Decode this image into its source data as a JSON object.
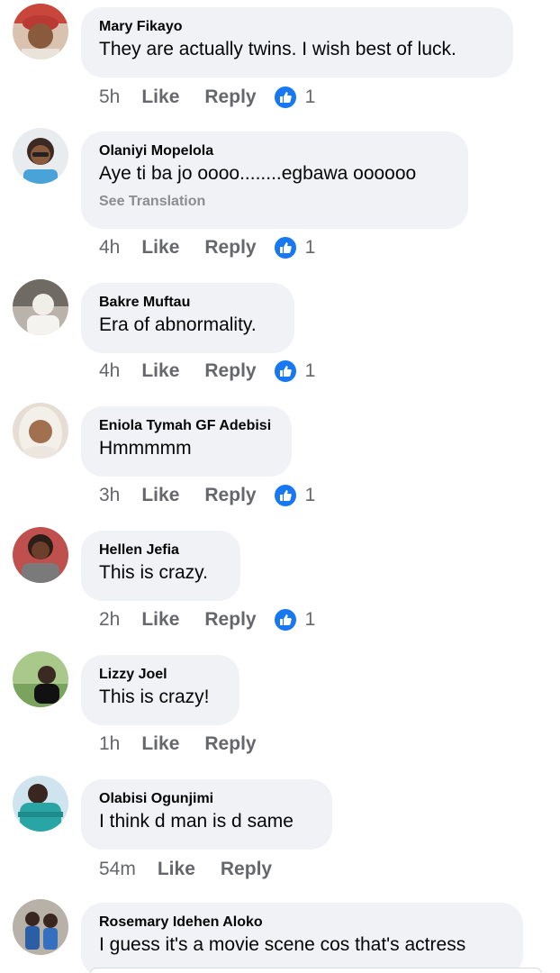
{
  "comments": [
    {
      "name": "Mary Fikayo",
      "text": "They are actually twins. I wish best of luck.",
      "time": "5h",
      "like": "Like",
      "reply": "Reply",
      "reactions": "1",
      "avatar": "avatar-photo"
    },
    {
      "name": "Olaniyi Mopelola",
      "text": "Aye ti ba jo oooo........egbawa oooooo",
      "translation": "See Translation",
      "time": "4h",
      "like": "Like",
      "reply": "Reply",
      "reactions": "1",
      "avatar": "avatar-photo"
    },
    {
      "name": "Bakre Muftau",
      "text": "Era of abnormality.",
      "time": "4h",
      "like": "Like",
      "reply": "Reply",
      "reactions": "1",
      "avatar": "avatar-photo"
    },
    {
      "name": "Eniola Tymah GF Adebisi",
      "text": "Hmmmmm",
      "time": "3h",
      "like": "Like",
      "reply": "Reply",
      "reactions": "1",
      "avatar": "avatar-photo"
    },
    {
      "name": "Hellen Jefia",
      "text": "This is crazy.",
      "time": "2h",
      "like": "Like",
      "reply": "Reply",
      "reactions": "1",
      "avatar": "avatar-photo"
    },
    {
      "name": "Lizzy Joel",
      "text": "This is crazy!",
      "time": "1h",
      "like": "Like",
      "reply": "Reply",
      "avatar": "avatar-photo"
    },
    {
      "name": "Olabisi Ogunjimi",
      "text": "I think d man is d same",
      "time": "54m",
      "like": "Like",
      "reply": "Reply",
      "avatar": "avatar-photo"
    },
    {
      "name": "Rosemary Idehen Aloko",
      "text": "I guess it's a movie scene cos that's actress",
      "avatar": "avatar-photo"
    }
  ],
  "colors": {
    "bubble": "#f0f2f5",
    "name": "#050505",
    "meta": "#65676b",
    "translation": "#8a8d91",
    "like_badge": "#1877f2"
  },
  "icons": {
    "reaction": "thumbs-up-icon"
  }
}
